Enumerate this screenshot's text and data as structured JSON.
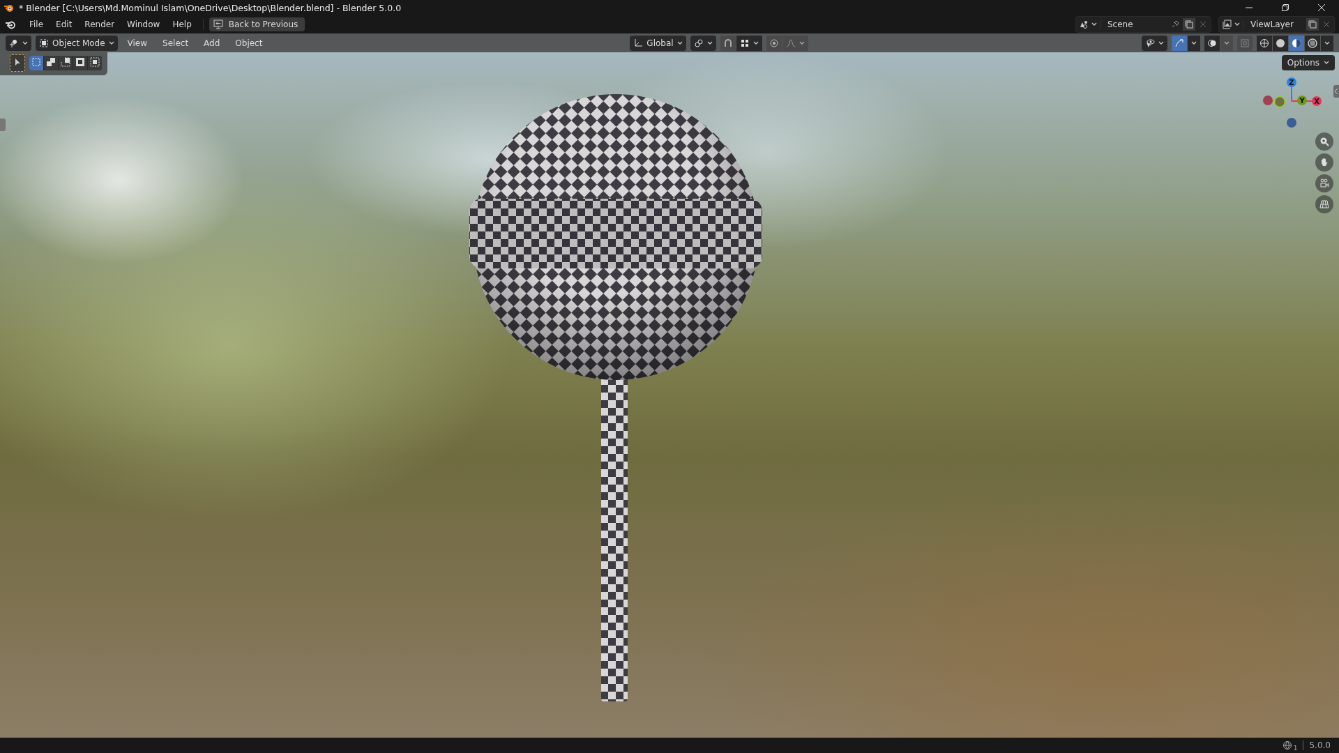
{
  "window": {
    "title": "* Blender [C:\\Users\\Md.Mominul Islam\\OneDrive\\Desktop\\Blender.blend] - Blender 5.0.0"
  },
  "menu_bar": {
    "items": [
      "File",
      "Edit",
      "Render",
      "Window",
      "Help"
    ],
    "back_button": "Back to Previous"
  },
  "scene": {
    "name": "Scene"
  },
  "view_layer": {
    "name": "ViewLayer"
  },
  "viewport_header": {
    "mode": "Object Mode",
    "menus": [
      "View",
      "Select",
      "Add",
      "Object"
    ],
    "orientation": "Global",
    "gizmos_on": true,
    "shading": [
      {
        "kind": "wireframe",
        "selected": false
      },
      {
        "kind": "solid",
        "selected": false
      },
      {
        "kind": "material",
        "selected": true
      },
      {
        "kind": "rendered",
        "selected": false
      }
    ]
  },
  "toolbar": {
    "select_tool_on": true,
    "select_modes": [
      {
        "kind": "set",
        "selected": true
      },
      {
        "kind": "extend",
        "selected": false
      },
      {
        "kind": "subtract",
        "selected": false
      },
      {
        "kind": "invert",
        "selected": false
      },
      {
        "kind": "intersect",
        "selected": false
      }
    ]
  },
  "options_button": "Options",
  "navigation_gizmo": {
    "axes": [
      {
        "label": "Z",
        "color": "#2f83e3"
      },
      {
        "label": "Y",
        "color": "#6f9a1d"
      },
      {
        "label": "X",
        "color": "#e8365b"
      }
    ]
  },
  "status_bar": {
    "scene_count": "1",
    "version": "5.0.0"
  }
}
